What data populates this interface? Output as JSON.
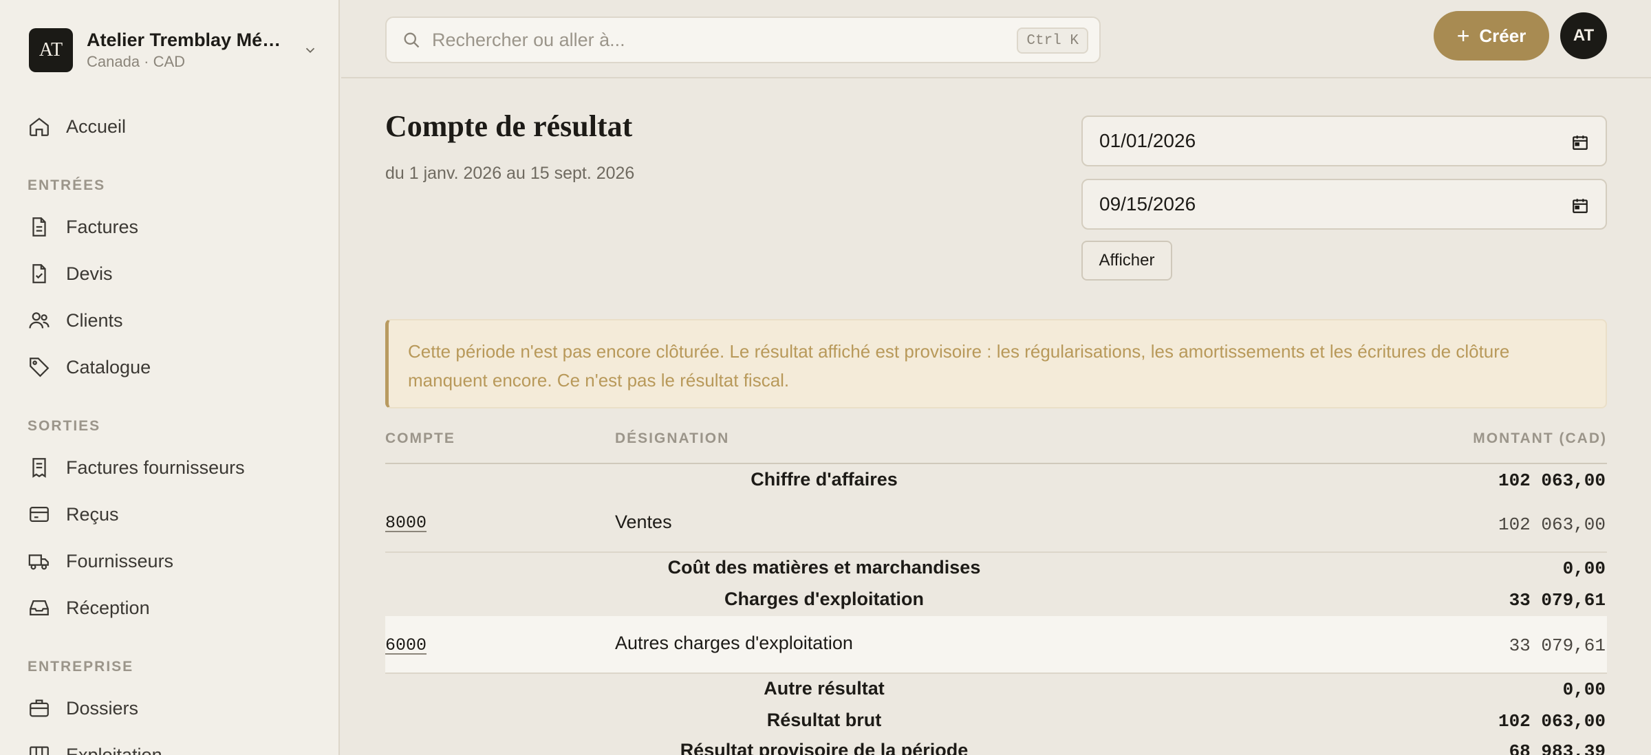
{
  "org": {
    "initials": "AT",
    "name": "Atelier Tremblay Mé…",
    "subtitle": "Canada · CAD"
  },
  "nav": {
    "home": "Accueil",
    "sections": [
      {
        "title": "ENTRÉES",
        "items": [
          "Factures",
          "Devis",
          "Clients",
          "Catalogue"
        ]
      },
      {
        "title": "SORTIES",
        "items": [
          "Factures fournisseurs",
          "Reçus",
          "Fournisseurs",
          "Réception"
        ]
      },
      {
        "title": "ENTREPRISE",
        "items": [
          "Dossiers",
          "Exploitation"
        ]
      }
    ]
  },
  "topbar": {
    "search_placeholder": "Rechercher ou aller à...",
    "shortcut": "Ctrl K",
    "create_label": "Créer",
    "avatar_initials": "AT"
  },
  "page": {
    "title": "Compte de résultat",
    "subtitle": "du 1 janv. 2026 au 15 sept. 2026",
    "date_from": "01/01/2026",
    "date_to": "09/15/2026",
    "show_label": "Afficher",
    "notice": "Cette période n'est pas encore clôturée. Le résultat affiché est provisoire : les régularisations, les amortissements et les écritures de clôture manquent encore. Ce n'est pas le résultat fiscal."
  },
  "table": {
    "headers": {
      "account": "COMPTE",
      "designation": "DÉSIGNATION",
      "amount": "MONTANT (CAD)"
    },
    "rows": [
      {
        "type": "group",
        "label": "Chiffre d'affaires",
        "amount": "102 063,00"
      },
      {
        "type": "line",
        "account": "8000",
        "designation": "Ventes",
        "amount": "102 063,00"
      },
      {
        "type": "group",
        "label": "Coût des matières et marchandises",
        "amount": "0,00"
      },
      {
        "type": "group",
        "label": "Charges d'exploitation",
        "amount": "33 079,61"
      },
      {
        "type": "line",
        "account": "6000",
        "designation": "Autres charges d'exploitation",
        "amount": "33 079,61"
      },
      {
        "type": "group",
        "label": "Autre résultat",
        "amount": "0,00"
      },
      {
        "type": "group",
        "label": "Résultat brut",
        "amount": "102 063,00"
      },
      {
        "type": "group",
        "label": "Résultat provisoire de la période",
        "amount": "68 983,39"
      }
    ]
  }
}
